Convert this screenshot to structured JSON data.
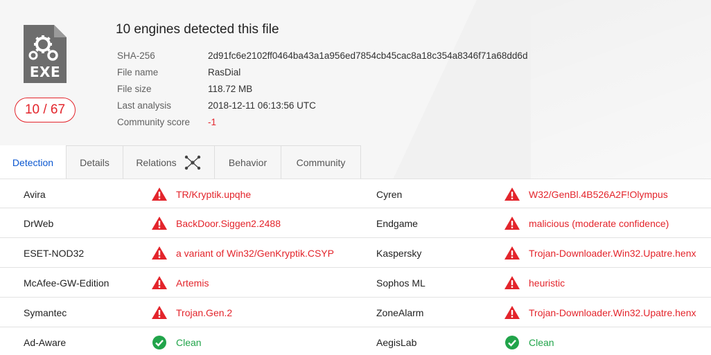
{
  "file": {
    "type_label": "EXE",
    "score": "10 / 67",
    "title": "10 engines detected this file",
    "meta": [
      {
        "key": "SHA-256",
        "value": "2d91fc6e2102ff0464ba43a1a956ed7854cb45cac8a18c354a8346f71a68dd6d"
      },
      {
        "key": "File name",
        "value": "RasDial"
      },
      {
        "key": "File size",
        "value": "118.72 MB"
      },
      {
        "key": "Last analysis",
        "value": "2018-12-11 06:13:56 UTC"
      },
      {
        "key": "Community score",
        "value": "-1"
      }
    ]
  },
  "tabs": [
    {
      "label": "Detection",
      "active": true
    },
    {
      "label": "Details"
    },
    {
      "label": "Relations",
      "icon": "graph-icon"
    },
    {
      "label": "Behavior"
    },
    {
      "label": "Community"
    }
  ],
  "detections": [
    {
      "left": {
        "engine": "Avira",
        "result": "TR/Kryptik.upqhe",
        "status": "malicious"
      },
      "right": {
        "engine": "Cyren",
        "result": "W32/GenBl.4B526A2F!Olympus",
        "status": "malicious"
      }
    },
    {
      "left": {
        "engine": "DrWeb",
        "result": "BackDoor.Siggen2.2488",
        "status": "malicious"
      },
      "right": {
        "engine": "Endgame",
        "result": "malicious (moderate confidence)",
        "status": "malicious"
      }
    },
    {
      "left": {
        "engine": "ESET-NOD32",
        "result": "a variant of Win32/GenKryptik.CSYP",
        "status": "malicious"
      },
      "right": {
        "engine": "Kaspersky",
        "result": "Trojan-Downloader.Win32.Upatre.henx",
        "status": "malicious"
      }
    },
    {
      "left": {
        "engine": "McAfee-GW-Edition",
        "result": "Artemis",
        "status": "malicious"
      },
      "right": {
        "engine": "Sophos ML",
        "result": "heuristic",
        "status": "malicious"
      }
    },
    {
      "left": {
        "engine": "Symantec",
        "result": "Trojan.Gen.2",
        "status": "malicious"
      },
      "right": {
        "engine": "ZoneAlarm",
        "result": "Trojan-Downloader.Win32.Upatre.henx",
        "status": "malicious"
      }
    },
    {
      "left": {
        "engine": "Ad-Aware",
        "result": "Clean",
        "status": "clean"
      },
      "right": {
        "engine": "AegisLab",
        "result": "Clean",
        "status": "clean"
      }
    }
  ],
  "colors": {
    "malicious": "#e3242b",
    "clean": "#21a44a",
    "active_tab": "#0b57d0",
    "icon_gray": "#6d6d6d"
  }
}
